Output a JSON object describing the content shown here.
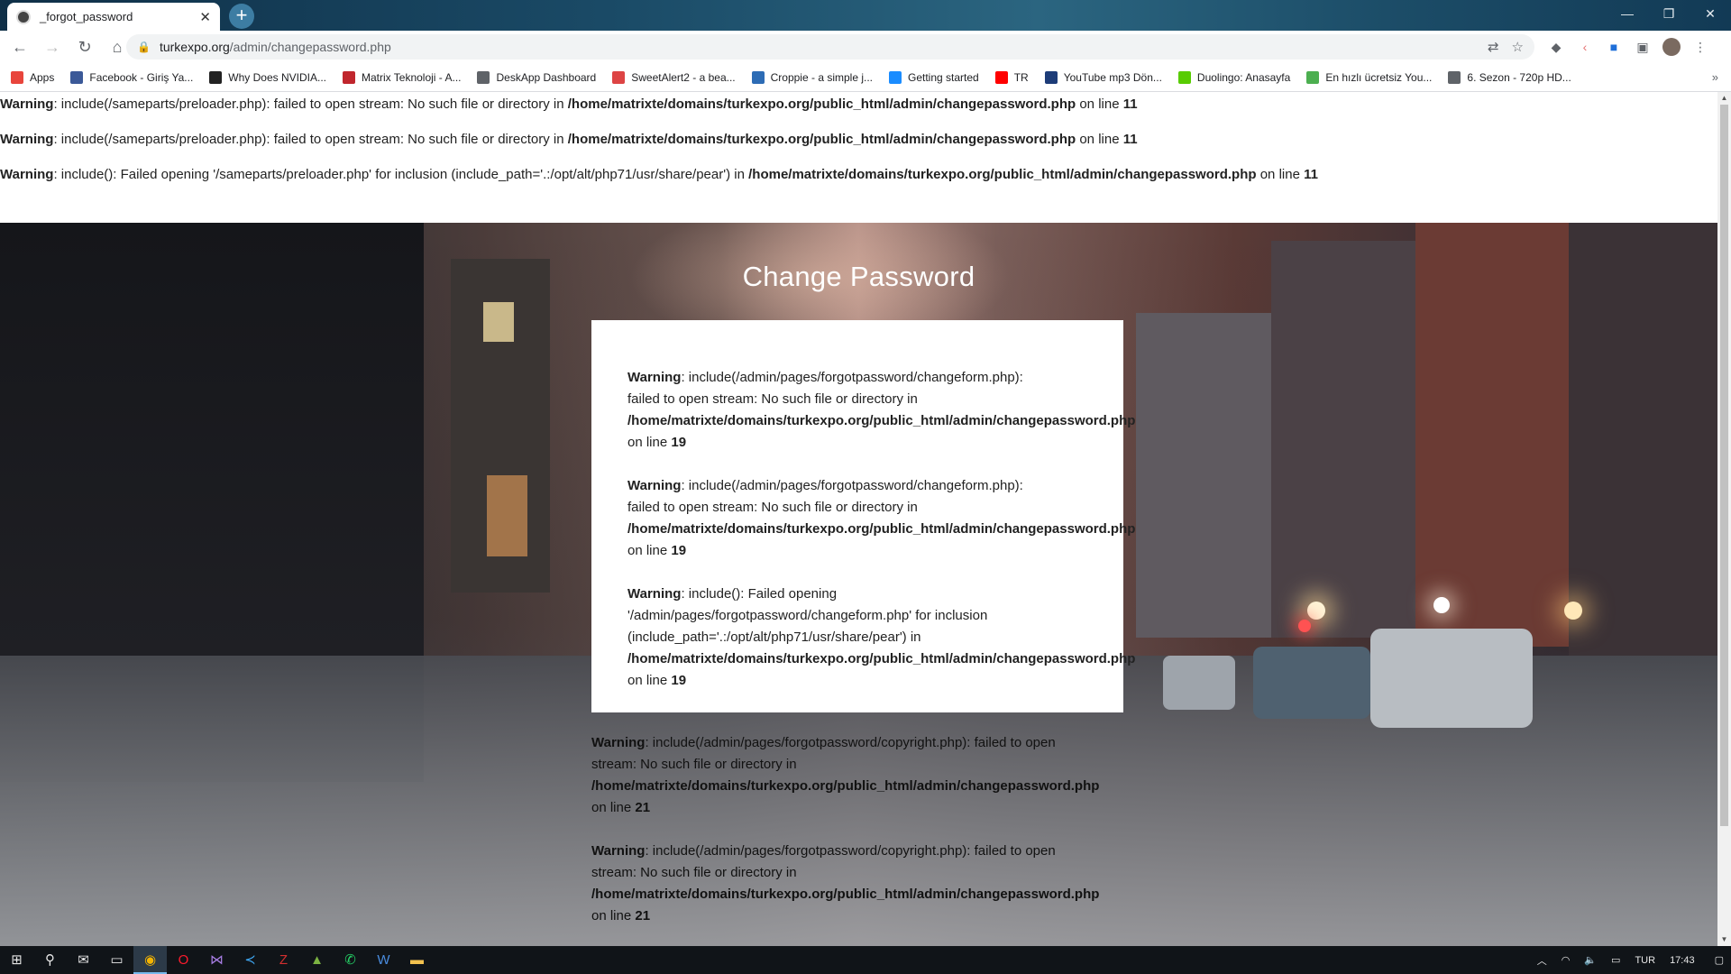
{
  "browser": {
    "tab_title": "_forgot_password",
    "url_host": "turkexpo.org",
    "url_path": "/admin/changepassword.php"
  },
  "bookmarks": [
    {
      "label": "Apps",
      "icon": "apps-grid-icon",
      "color": "#e8453c"
    },
    {
      "label": "Facebook - Giriş Ya...",
      "icon": "facebook-icon",
      "color": "#3b5998"
    },
    {
      "label": "Why Does NVIDIA...",
      "icon": "htg-icon",
      "color": "#222222"
    },
    {
      "label": "Matrix Teknoloji - A...",
      "icon": "matrix-icon",
      "color": "#c0262d"
    },
    {
      "label": "DeskApp Dashboard",
      "icon": "globe-icon",
      "color": "#5f6368"
    },
    {
      "label": "SweetAlert2 - a bea...",
      "icon": "sweetalert-icon",
      "color": "#d44"
    },
    {
      "label": "Croppie - a simple j...",
      "icon": "croppie-icon",
      "color": "#2d6cb5"
    },
    {
      "label": "Getting started",
      "icon": "getting-started-icon",
      "color": "#1a8cff"
    },
    {
      "label": "TR",
      "icon": "youtube-icon",
      "color": "#ff0000"
    },
    {
      "label": "YouTube mp3 Dön...",
      "icon": "yt-mp3-icon",
      "color": "#1d3c78"
    },
    {
      "label": "Duolingo: Anasayfa",
      "icon": "duolingo-icon",
      "color": "#58cc02"
    },
    {
      "label": "En hızlı ücretsiz You...",
      "icon": "download-icon",
      "color": "#4caf50"
    },
    {
      "label": "6. Sezon - 720p HD...",
      "icon": "globe-icon",
      "color": "#5f6368"
    }
  ],
  "top_warnings": [
    {
      "label": "Warning",
      "text": ": include(/sameparts/preloader.php): failed to open stream: No such file or directory in ",
      "path": "/home/matrixte/domains/turkexpo.org/public_html/admin/changepassword.php",
      "suffix": " on line ",
      "line": "11"
    },
    {
      "label": "Warning",
      "text": ": include(/sameparts/preloader.php): failed to open stream: No such file or directory in ",
      "path": "/home/matrixte/domains/turkexpo.org/public_html/admin/changepassword.php",
      "suffix": " on line ",
      "line": "11"
    },
    {
      "label": "Warning",
      "text": ": include(): Failed opening '/sameparts/preloader.php' for inclusion (include_path='.:/opt/alt/php71/usr/share/pear') in ",
      "path": "/home/matrixte/domains/turkexpo.org/public_html/admin/changepassword.php",
      "suffix": " on line ",
      "line": "11"
    }
  ],
  "page_title": "Change Password",
  "card_warnings": [
    {
      "label": "Warning",
      "l1": ": include(/admin/pages/forgotpassword/changeform.php):",
      "l2": "failed to open stream: No such file or directory in",
      "l3": "",
      "path": "/home/matrixte/domains/turkexpo.org/public_html/admin/changepassword.php",
      "suffix": "on line ",
      "line": "19"
    },
    {
      "label": "Warning",
      "l1": ": include(/admin/pages/forgotpassword/changeform.php):",
      "l2": "failed to open stream: No such file or directory in",
      "l3": "",
      "path": "/home/matrixte/domains/turkexpo.org/public_html/admin/changepassword.php",
      "suffix": "on line ",
      "line": "19"
    },
    {
      "label": "Warning",
      "l1": ": include(): Failed opening",
      "l2": "'/admin/pages/forgotpassword/changeform.php' for inclusion",
      "l3": "(include_path='.:/opt/alt/php71/usr/share/pear') in",
      "path": "/home/matrixte/domains/turkexpo.org/public_html/admin/changepassword.php",
      "suffix": "on line ",
      "line": "19"
    }
  ],
  "footer_warnings": [
    {
      "label": "Warning",
      "l1": ": include(/admin/pages/forgotpassword/copyright.php): failed to open",
      "l2": "stream: No such file or directory in",
      "path": "/home/matrixte/domains/turkexpo.org/public_html/admin/changepassword.php",
      "suffix": "on line ",
      "line": "21"
    },
    {
      "label": "Warning",
      "l1": ": include(/admin/pages/forgotpassword/copyright.php): failed to open",
      "l2": "stream: No such file or directory in",
      "path": "/home/matrixte/domains/turkexpo.org/public_html/admin/changepassword.php",
      "suffix": "on line ",
      "line": "21"
    }
  ],
  "taskbar": {
    "apps": [
      "windows-start-icon",
      "search-icon",
      "mail-icon",
      "task-view-icon",
      "chrome-icon",
      "opera-icon",
      "visual-studio-icon",
      "vscode-icon",
      "filezilla-icon",
      "android-studio-icon",
      "whatsapp-icon",
      "word-icon",
      "file-explorer-icon"
    ],
    "language": "TUR",
    "time": "17:43"
  }
}
